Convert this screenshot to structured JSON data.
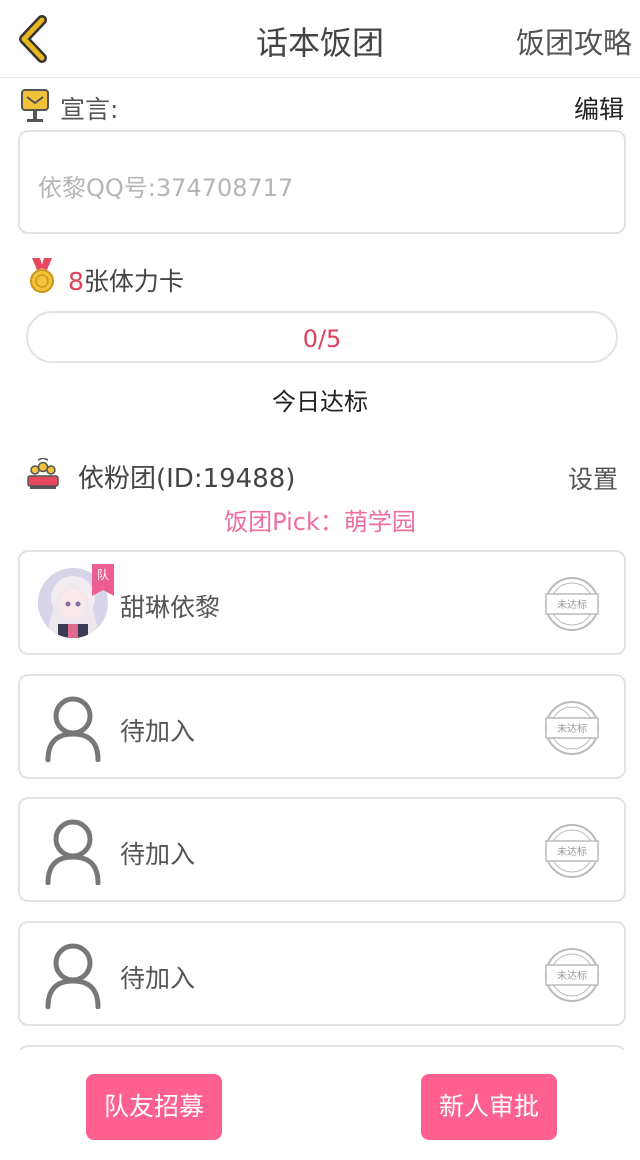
{
  "header": {
    "back_icon": "chevron-left-icon",
    "title": "话本饭团",
    "guide_label": "饭团攻略"
  },
  "declaration": {
    "icon": "mailbox-icon",
    "label": "宣言:",
    "edit_label": "编辑",
    "text": "依黎QQ号:374708717"
  },
  "stamina": {
    "icon": "medal-icon",
    "count": "8",
    "label": "张体力卡"
  },
  "progress": {
    "text": "0/5",
    "current": 0,
    "total": 5,
    "fill_color": "#ff6a95",
    "caption": "今日达标"
  },
  "team": {
    "icon": "team-crown-icon",
    "name": "依粉团(ID:19488)",
    "settings_label": "设置",
    "pick_text": "饭团Pick：萌学园"
  },
  "members": [
    {
      "name": "甜琳依黎",
      "badge": "队",
      "status": "未达标",
      "avatar": "anime-avatar"
    },
    {
      "name": "待加入",
      "status": "未达标",
      "avatar": "person-icon"
    },
    {
      "name": "待加入",
      "status": "未达标",
      "avatar": "person-icon"
    },
    {
      "name": "待加入",
      "status": "未达标",
      "avatar": "person-icon"
    }
  ],
  "actions": {
    "recruit_label": "队友招募",
    "approve_label": "新人审批",
    "button_color": "#ff6090"
  },
  "colors": {
    "accent_pink": "#ef6ea0",
    "highlight_red": "#e0405b",
    "back_icon_gold": "#d4a21a"
  }
}
